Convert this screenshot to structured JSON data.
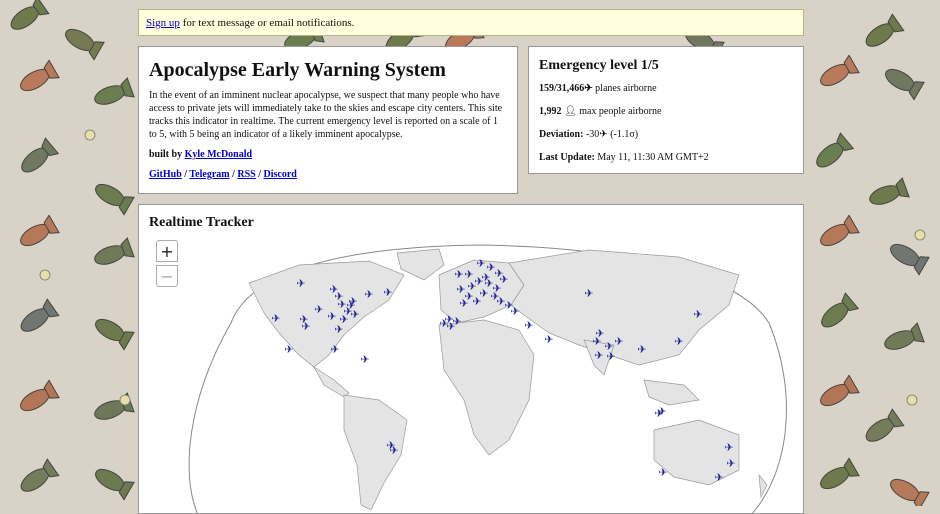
{
  "notice": {
    "link": "Sign up",
    "text": " for text message or email notifications."
  },
  "about": {
    "title": "Apocalypse Early Warning System",
    "description": "In the event of an imminent nuclear apocalypse, we suspect that many people who have access to private jets will immediately take to the skies and escape city centers. This site tracks this indicator in realtime. The current emergency level is reported on a scale of 1 to 5, with 5 being an indicator of a likely imminent apocalypse.",
    "built_by_prefix": "built by ",
    "author": "Kyle McDonald",
    "links": [
      "GitHub",
      "Telegram",
      "RSS",
      "Discord"
    ]
  },
  "status": {
    "emergency_level": "Emergency level 1/5",
    "planes_count": "159/31,466",
    "planes_label": "planes airborne",
    "people_count": "1,992",
    "people_label": "max people airborne",
    "deviation_label": "Deviation:",
    "deviation_value": "-30",
    "deviation_sigma": "(-1.1σ)",
    "update_label": "Last Update:",
    "update_value": "May 11, 11:30 AM GMT+2"
  },
  "tracker": {
    "title": "Realtime Tracker",
    "zoom_in": "+",
    "zoom_out": "−"
  },
  "colors": {
    "plane": "#1f1f99",
    "background": "#d8d3c6",
    "notice_bg": "#ffffde",
    "link": "#0000cc"
  },
  "icons": {
    "plane": "airplane-icon",
    "person": "person-icon"
  }
}
